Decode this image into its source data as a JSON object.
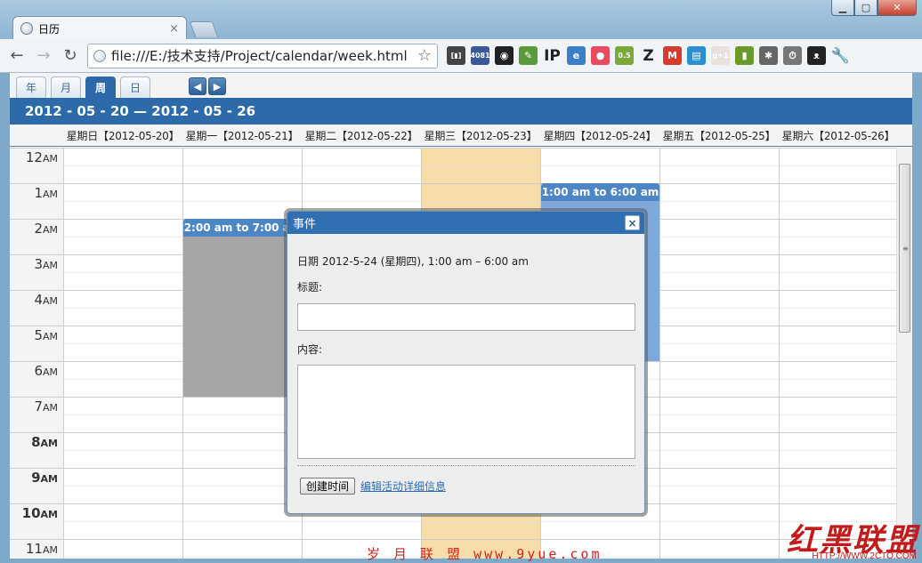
{
  "browser": {
    "tab_title": "日历",
    "tab_close": "×",
    "url": "file:///E:/技术支持/Project/calendar/week.html",
    "window_controls": {
      "minimize": "▁",
      "maximize": "▢",
      "close": "✕"
    },
    "nav": {
      "back": "←",
      "forward": "→",
      "reload": "↻",
      "star": "☆"
    },
    "extensions": [
      {
        "icon": "cache-icon",
        "text": "[▮]",
        "color": "#444444"
      },
      {
        "icon": "feed-counter-icon",
        "text": "4081",
        "color": "#3b5998"
      },
      {
        "icon": "camera-lens-icon",
        "text": "◉",
        "color": "#222222"
      },
      {
        "icon": "pen-icon",
        "text": "✎",
        "color": "#5a9a3a"
      },
      {
        "icon": "ip-icon",
        "text": "IP",
        "color": ""
      },
      {
        "icon": "page-capture-icon",
        "text": "e",
        "color": "#3d7ec9"
      },
      {
        "icon": "red-blob-icon",
        "text": "●",
        "color": "#e84a5f"
      },
      {
        "icon": "rating-badge-icon",
        "text": "0.5",
        "color": "#7aa83a"
      },
      {
        "icon": "z-icon",
        "text": "Z",
        "color": ""
      },
      {
        "icon": "gmail-icon",
        "text": "M",
        "color": "#d63b2f"
      },
      {
        "icon": "calendar-ext-icon",
        "text": "▤",
        "color": "#2a8fd1"
      },
      {
        "icon": "gplus-icon",
        "text": "g+1",
        "color": "#e9e1dc"
      },
      {
        "icon": "battery-icon",
        "text": "▮",
        "color": "#6a9a2a"
      },
      {
        "icon": "bug-icon",
        "text": "✱",
        "color": "#666666"
      },
      {
        "icon": "stopwatch-icon",
        "text": "⏱",
        "color": "#777777"
      },
      {
        "icon": "cat-icon",
        "text": "ᴥ",
        "color": "#222222"
      },
      {
        "icon": "wrench-icon",
        "text": "🔧",
        "color": ""
      }
    ]
  },
  "calendar": {
    "views": [
      {
        "label": "年",
        "active": false
      },
      {
        "label": "月",
        "active": false
      },
      {
        "label": "周",
        "active": true
      },
      {
        "label": "日",
        "active": false
      }
    ],
    "prev": "◀",
    "next": "▶",
    "range": "2012 - 05 - 20 — 2012 - 05 - 26",
    "days": [
      "星期日【2012-05-20】",
      "星期一【2012-05-21】",
      "星期二【2012-05-22】",
      "星期三【2012-05-23】",
      "星期四【2012-05-24】",
      "星期五【2012-05-25】",
      "星期六【2012-05-26】"
    ],
    "today_index": 3,
    "hours": [
      {
        "num": "12",
        "ampm": "AM"
      },
      {
        "num": "1",
        "ampm": "AM"
      },
      {
        "num": "2",
        "ampm": "AM"
      },
      {
        "num": "3",
        "ampm": "AM"
      },
      {
        "num": "4",
        "ampm": "AM"
      },
      {
        "num": "5",
        "ampm": "AM"
      },
      {
        "num": "6",
        "ampm": "AM"
      },
      {
        "num": "7",
        "ampm": "AM"
      },
      {
        "num": "8",
        "ampm": "AM"
      },
      {
        "num": "9",
        "ampm": "AM"
      },
      {
        "num": "10",
        "ampm": "AM"
      },
      {
        "num": "11",
        "ampm": "AM"
      }
    ],
    "events": [
      {
        "label": "2:00 am to 7:00 am",
        "day": 1,
        "start": 2,
        "end": 7,
        "style": "grey"
      },
      {
        "label": "1:00 am to 6:00 am",
        "day": 4,
        "start": 1,
        "end": 6,
        "style": "blue"
      }
    ]
  },
  "dialog": {
    "title": "事件",
    "close": "×",
    "date_line": "日期 2012-5-24 (星期四), 1:00 am – 6:00 am",
    "title_label": "标题:",
    "title_value": "",
    "content_label": "内容:",
    "content_value": "",
    "create_button": "创建时间",
    "edit_link": "编辑活动详细信息"
  },
  "watermarks": {
    "center": "岁 月 联 盟  www.9yue.com",
    "logo": "红黑联盟",
    "url": "HTTP://WWW.2CTO.COM"
  }
}
